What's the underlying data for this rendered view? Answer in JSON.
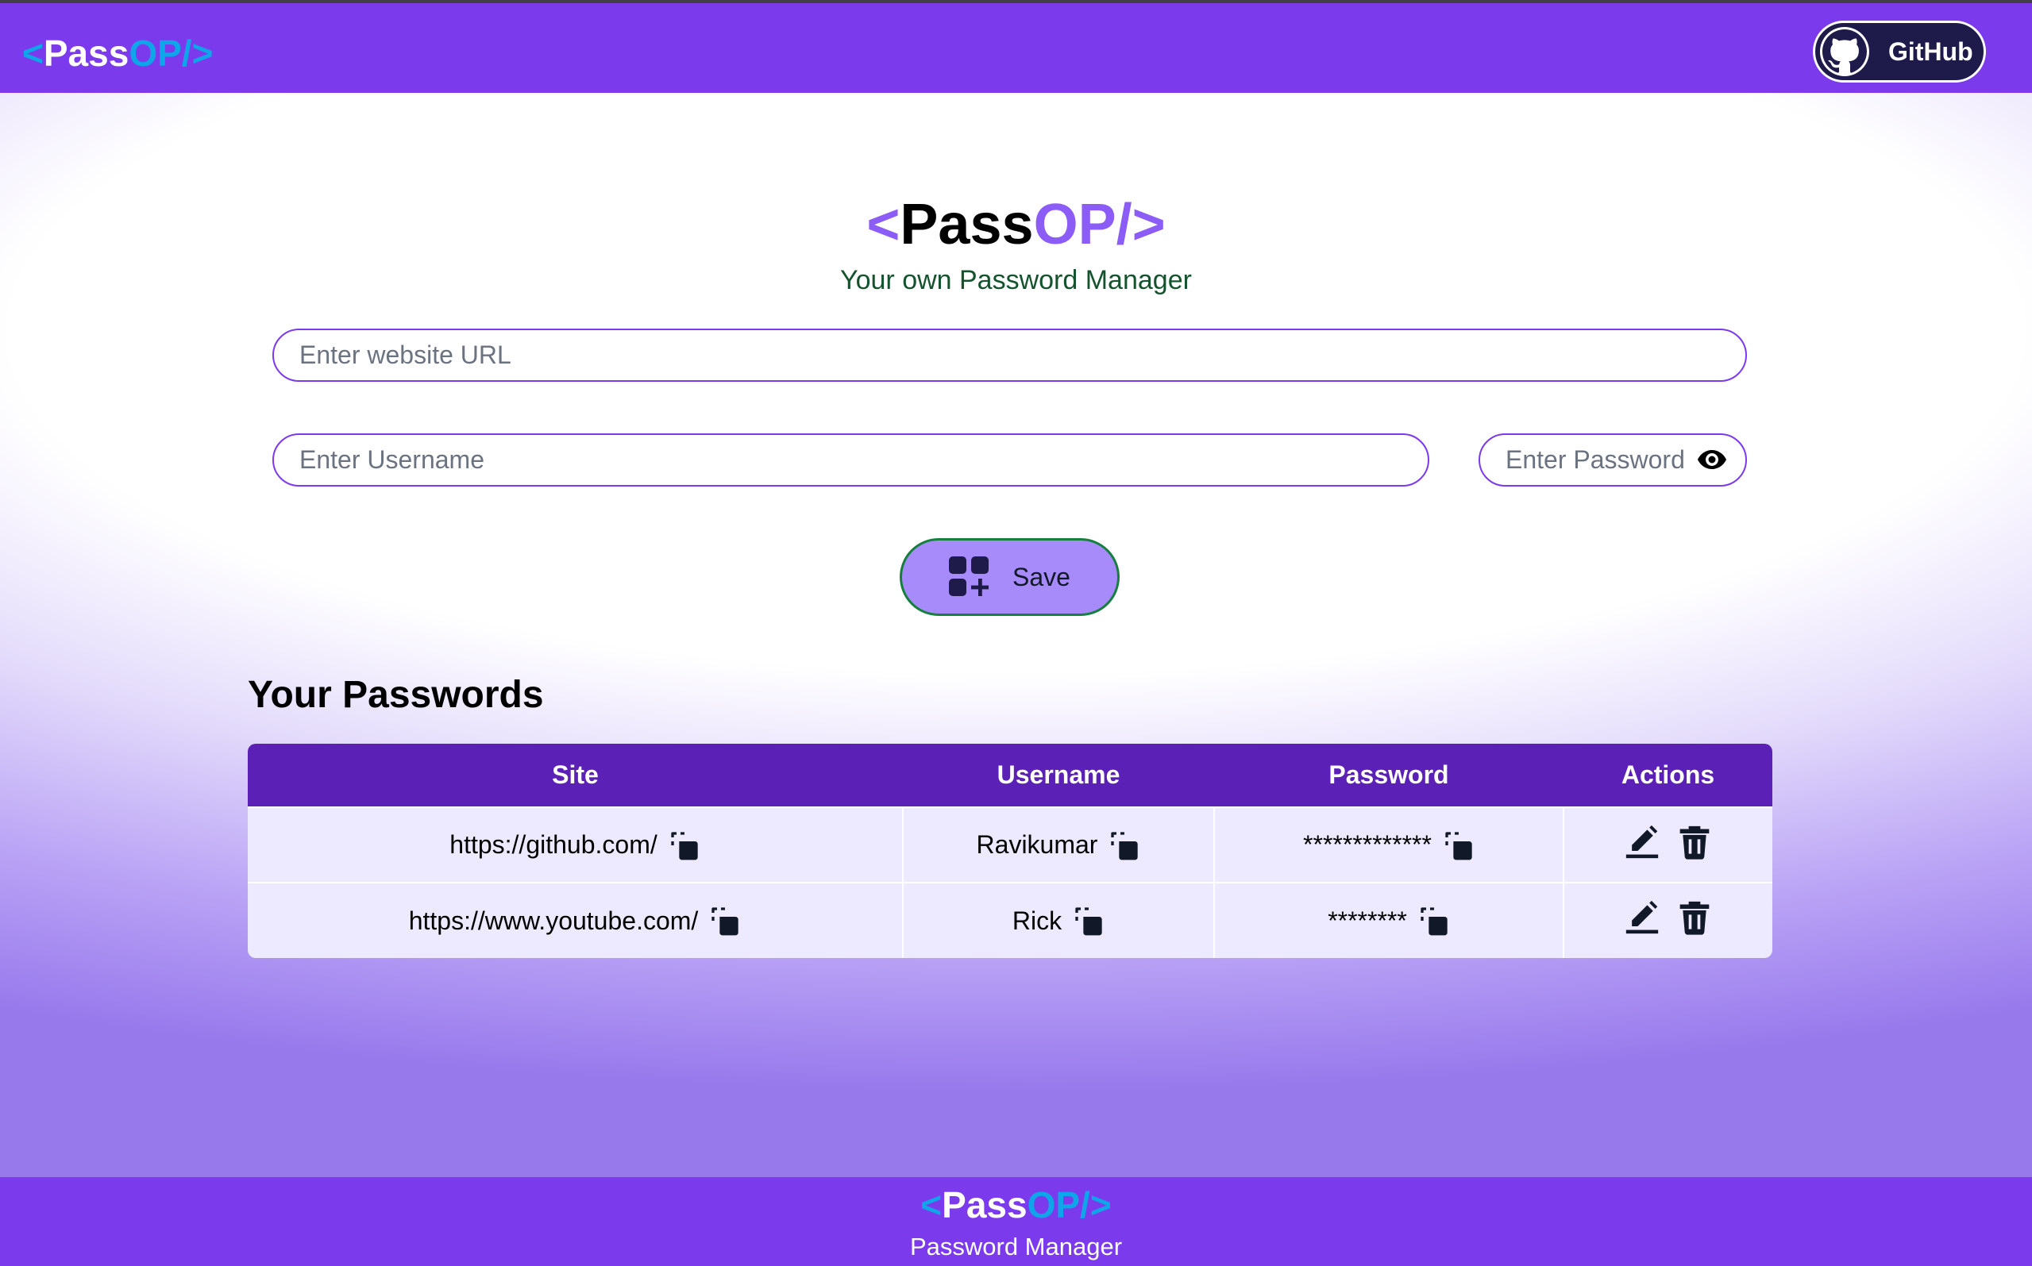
{
  "navbar": {
    "logo": {
      "open": "<",
      "pass": "Pass",
      "op": "OP/",
      "close": ">"
    },
    "github_label": "GitHub"
  },
  "hero": {
    "title": {
      "open": "<",
      "pass": "Pass",
      "op": "OP/",
      "close": ">"
    },
    "subtitle": "Your own Password Manager"
  },
  "form": {
    "url_placeholder": "Enter website URL",
    "username_placeholder": "Enter Username",
    "password_placeholder": "Enter Password",
    "save_label": "Save"
  },
  "passwords": {
    "title": "Your Passwords",
    "columns": [
      "Site",
      "Username",
      "Password",
      "Actions"
    ],
    "rows": [
      {
        "site": "https://github.com/",
        "username": "Ravikumar",
        "password": "*************"
      },
      {
        "site": "https://www.youtube.com/",
        "username": "Rick",
        "password": "********"
      }
    ]
  },
  "footer": {
    "logo": {
      "open": "<",
      "pass": "Pass",
      "op": "OP/",
      "close": ">"
    },
    "subtitle": "Password Manager"
  },
  "colors": {
    "brand": "#7c3aed",
    "table_header": "#5b21b6",
    "row_bg": "#ede9fe",
    "accent_blue": "#0ea5e9",
    "save_button": "#a78bfa",
    "subtitle_green": "#14532d"
  },
  "icons": {
    "github": "github-icon",
    "eye": "eye-icon",
    "save": "add-grid-icon",
    "copy": "copy-icon",
    "edit": "edit-icon",
    "delete": "trash-icon"
  }
}
